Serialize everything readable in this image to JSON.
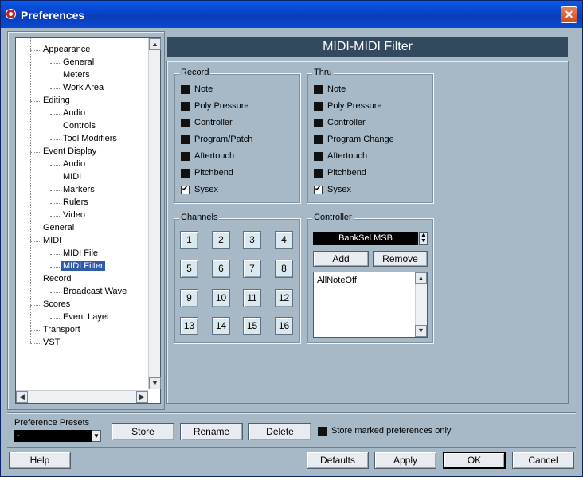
{
  "window": {
    "title": "Preferences",
    "close_label": "✕"
  },
  "tree": {
    "items": [
      {
        "label": "Appearance",
        "level": 0
      },
      {
        "label": "General",
        "level": 1
      },
      {
        "label": "Meters",
        "level": 1
      },
      {
        "label": "Work Area",
        "level": 1
      },
      {
        "label": "Editing",
        "level": 0
      },
      {
        "label": "Audio",
        "level": 1
      },
      {
        "label": "Controls",
        "level": 1
      },
      {
        "label": "Tool Modifiers",
        "level": 1
      },
      {
        "label": "Event Display",
        "level": 0
      },
      {
        "label": "Audio",
        "level": 1
      },
      {
        "label": "MIDI",
        "level": 1
      },
      {
        "label": "Markers",
        "level": 1
      },
      {
        "label": "Rulers",
        "level": 1
      },
      {
        "label": "Video",
        "level": 1
      },
      {
        "label": "General",
        "level": 0
      },
      {
        "label": "MIDI",
        "level": 0
      },
      {
        "label": "MIDI File",
        "level": 1
      },
      {
        "label": "MIDI Filter",
        "level": 1,
        "selected": true
      },
      {
        "label": "Record",
        "level": 0
      },
      {
        "label": "Broadcast Wave",
        "level": 1
      },
      {
        "label": "Scores",
        "level": 0
      },
      {
        "label": "Event Layer",
        "level": 1
      },
      {
        "label": "Transport",
        "level": 0
      },
      {
        "label": "VST",
        "level": 0
      }
    ],
    "scroll_up": "▲",
    "scroll_down": "▼",
    "scroll_left": "◀",
    "scroll_right": "▶"
  },
  "header": {
    "title": "MIDI-MIDI Filter"
  },
  "record": {
    "title": "Record",
    "items": [
      {
        "label": "Note",
        "checked": false
      },
      {
        "label": "Poly Pressure",
        "checked": false
      },
      {
        "label": "Controller",
        "checked": false
      },
      {
        "label": "Program/Patch",
        "checked": false
      },
      {
        "label": "Aftertouch",
        "checked": false
      },
      {
        "label": "Pitchbend",
        "checked": false
      },
      {
        "label": "Sysex",
        "checked": true
      }
    ]
  },
  "thru": {
    "title": "Thru",
    "items": [
      {
        "label": "Note",
        "checked": false
      },
      {
        "label": "Poly Pressure",
        "checked": false
      },
      {
        "label": "Controller",
        "checked": false
      },
      {
        "label": "Program Change",
        "checked": false
      },
      {
        "label": "Aftertouch",
        "checked": false
      },
      {
        "label": "Pitchbend",
        "checked": false
      },
      {
        "label": "Sysex",
        "checked": true
      }
    ]
  },
  "channels": {
    "title": "Channels",
    "buttons": [
      "1",
      "2",
      "3",
      "4",
      "5",
      "6",
      "7",
      "8",
      "9",
      "10",
      "11",
      "12",
      "13",
      "14",
      "15",
      "16"
    ]
  },
  "controller": {
    "title": "Controller",
    "selected": "BankSel MSB",
    "add_label": "Add",
    "remove_label": "Remove",
    "list": [
      "AllNoteOff"
    ]
  },
  "presets": {
    "label": "Preference Presets",
    "value": "-",
    "store_label": "Store",
    "rename_label": "Rename",
    "delete_label": "Delete",
    "store_marked_label": "Store marked preferences only",
    "store_marked_checked": false
  },
  "footer": {
    "help_label": "Help",
    "defaults_label": "Defaults",
    "apply_label": "Apply",
    "ok_label": "OK",
    "cancel_label": "Cancel"
  },
  "colors": {
    "title_bar": "#0a4ad0",
    "dialog_bg": "#a7b8c6",
    "header_bg": "#334a5e",
    "selection": "#2f5aa8"
  }
}
